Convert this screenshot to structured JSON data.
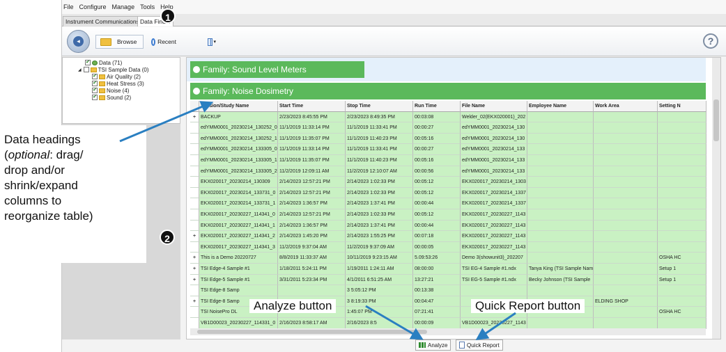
{
  "menu": [
    "File",
    "Configure",
    "Manage",
    "Tools",
    "Help"
  ],
  "tabs": [
    "Instrument Communications",
    "Data Finder"
  ],
  "toolbar": {
    "browse": "Browse",
    "recent": "Recent",
    "help": "?"
  },
  "tree": [
    {
      "label": "Data (71)",
      "checked": true,
      "indent": 0
    },
    {
      "label": "TSI Sample Data (0)",
      "checked": false,
      "indent": 0
    },
    {
      "label": "Air Quality (2)",
      "checked": true,
      "indent": 1
    },
    {
      "label": "Heat Stress (3)",
      "checked": true,
      "indent": 1
    },
    {
      "label": "Noise (4)",
      "checked": true,
      "indent": 1
    },
    {
      "label": "Sound (2)",
      "checked": true,
      "indent": 1
    }
  ],
  "families": {
    "sound": "Family: Sound Level Meters",
    "noise": "Family: Noise Dosimetry"
  },
  "table": {
    "headers": [
      "",
      "Session/Study Name",
      "Start Time",
      "Stop Time",
      "Run Time",
      "File Name",
      "Employee Name",
      "Work Area",
      "Setting N"
    ],
    "rows": [
      [
        "+",
        "BACKUP",
        "2/23/2023 8:45:55 PM",
        "2/23/2023 8:49:35 PM",
        "00:03:08",
        "Welder_02(EKX020001)_202",
        "",
        "",
        ""
      ],
      [
        "",
        "edYMM0001_20230214_130252_0",
        "11/1/2019 11:33:14 PM",
        "11/1/2019 11:33:41 PM",
        "00:00:27",
        "edYMM0001_20230214_130",
        "",
        "",
        ""
      ],
      [
        "",
        "edYMM0001_20230214_130252_1",
        "11/1/2019 11:35:07 PM",
        "11/1/2019 11:40:23 PM",
        "00:05:16",
        "edYMM0001_20230214_130",
        "",
        "",
        ""
      ],
      [
        "",
        "edYMM0001_20230214_133305_0",
        "11/1/2019 11:33:14 PM",
        "11/1/2019 11:33:41 PM",
        "00:00:27",
        "edYMM0001_20230214_133",
        "",
        "",
        ""
      ],
      [
        "",
        "edYMM0001_20230214_133305_1",
        "11/1/2019 11:35:07 PM",
        "11/1/2019 11:40:23 PM",
        "00:05:16",
        "edYMM0001_20230214_133",
        "",
        "",
        ""
      ],
      [
        "",
        "edYMM0001_20230214_133305_2",
        "11/2/2019 12:09:11 AM",
        "11/2/2019 12:10:07 AM",
        "00:00:56",
        "edYMM0001_20230214_133",
        "",
        "",
        ""
      ],
      [
        "",
        "EKX020017_20230214_130309",
        "2/14/2023 12:57:21 PM",
        "2/14/2023 1:02:33 PM",
        "00:05:12",
        "EKX020017_20230214_1303",
        "",
        "",
        ""
      ],
      [
        "",
        "EKX020017_20230214_133731_0",
        "2/14/2023 12:57:21 PM",
        "2/14/2023 1:02:33 PM",
        "00:05:12",
        "EKX020017_20230214_1337",
        "",
        "",
        ""
      ],
      [
        "",
        "EKX020017_20230214_133731_1",
        "2/14/2023 1:36:57 PM",
        "2/14/2023 1:37:41 PM",
        "00:00:44",
        "EKX020017_20230214_1337",
        "",
        "",
        ""
      ],
      [
        "",
        "EKX020017_20230227_114341_0",
        "2/14/2023 12:57:21 PM",
        "2/14/2023 1:02:33 PM",
        "00:05:12",
        "EKX020017_20230227_1143",
        "",
        "",
        ""
      ],
      [
        "",
        "EKX020017_20230227_114341_1",
        "2/14/2023 1:36:57 PM",
        "2/14/2023 1:37:41 PM",
        "00:00:44",
        "EKX020017_20230227_1143",
        "",
        "",
        ""
      ],
      [
        "+",
        "EKX020017_20230227_114341_2",
        "2/14/2023 1:45:20 PM",
        "2/14/2023 1:55:25 PM",
        "00:07:18",
        "EKX020017_20230227_1143",
        "",
        "",
        ""
      ],
      [
        "",
        "EKX020017_20230227_114341_3",
        "11/2/2019 9:37:04 AM",
        "11/2/2019 9:37:09 AM",
        "00:00:05",
        "EKX020017_20230227_1143",
        "",
        "",
        ""
      ],
      [
        "+",
        "This is a Demo 20220727",
        "8/8/2019 11:33:37 AM",
        "10/11/2019 9:23:15 AM",
        "5.09:53:26",
        "Demo 3(showunit3)_202207",
        "",
        "",
        "OSHA HC"
      ],
      [
        "+",
        "TSI Edge-4 Sample #1",
        "1/18/2011 5:24:11 PM",
        "1/19/2011 1:24:11 AM",
        "08:00:00",
        "TSI EG-4 Sample #1.ndx",
        "Tanya King (TSI Sample Nam",
        "",
        "Setup 1"
      ],
      [
        "+",
        "TSI Edge-5 Sample #1",
        "3/31/2011 5:23:34 PM",
        "4/1/2011 6:51:25 AM",
        "13:27:21",
        "TSI EG-5 Sample #1.ndx",
        "Becky Johnson (TSI Sample",
        "",
        "Setup 1"
      ],
      [
        "",
        "TSI Edge-8 Samp",
        "",
        "3 5:05:12 PM",
        "00:13:38",
        "",
        "",
        "",
        ""
      ],
      [
        "+",
        "TSI Edge-8 Samp",
        "",
        "3 8:19:33 PM",
        "00:04:47",
        "",
        "",
        "ELDING SHOP",
        ""
      ],
      [
        "",
        "TSI NoisePro DL",
        "",
        "1:45:07 PM",
        "07:21:41",
        "",
        "",
        "",
        "OSHA HC"
      ],
      [
        "",
        "VB1D00023_20230227_114331_0",
        "2/16/2023 8:58:17 AM",
        "2/16/2023 8:5",
        "00:00:09",
        "VB1D00023_20230227_1143",
        "",
        "",
        ""
      ]
    ]
  },
  "buttons": {
    "analyze": "Analyze",
    "quick_report": "Quick Report"
  },
  "annotations": {
    "badge1": "1",
    "badge2": "2",
    "data_headings_l1": "Data headings",
    "data_headings_l2_italic": "optional",
    "data_headings_l2_rest": ":  drag/",
    "data_headings_l3": "drop and/or",
    "data_headings_l4": "shrink/expand",
    "data_headings_l5": "columns to",
    "data_headings_l6": "reorganize table)",
    "analyze_label": "Analyze button",
    "quick_report_label": "Quick Report button"
  },
  "colors": {
    "family_green": "#5bb95b",
    "row_green": "#c9f1c3",
    "arrow_blue": "#2a7fc1"
  }
}
